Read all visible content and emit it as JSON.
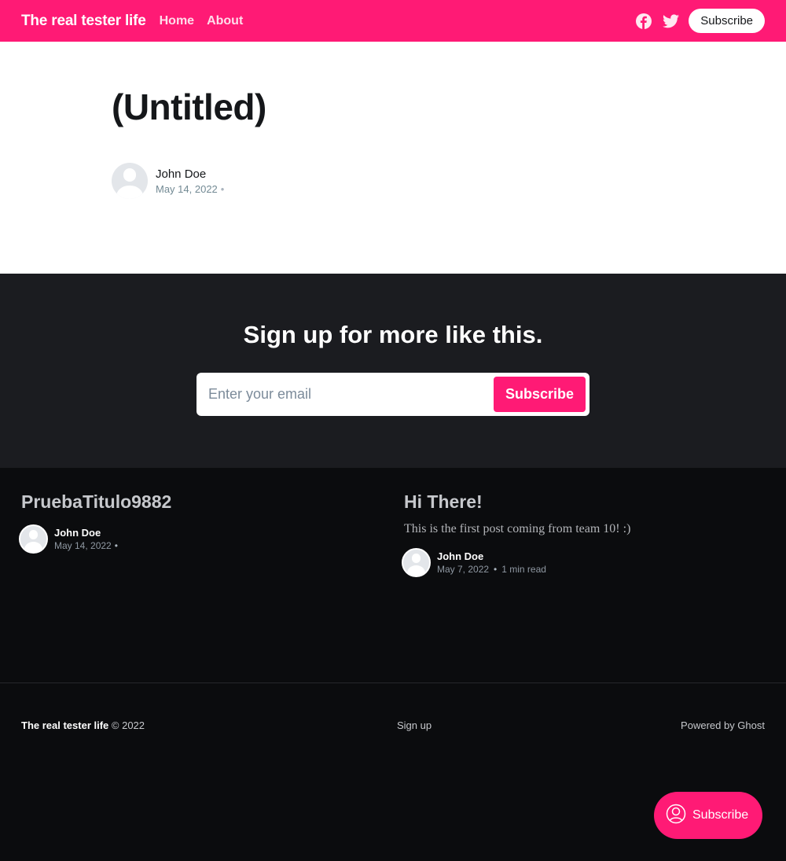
{
  "header": {
    "brand": "The real tester life",
    "nav": [
      {
        "label": "Home"
      },
      {
        "label": "About"
      }
    ],
    "subscribe_label": "Subscribe",
    "accent_color": "#ff1a75",
    "icons": [
      "facebook-icon",
      "twitter-icon"
    ]
  },
  "article": {
    "title": "(Untitled)",
    "author": "John Doe",
    "date": "May 14, 2022",
    "separator": "•"
  },
  "signup": {
    "heading": "Sign up for more like this.",
    "email_placeholder": "Enter your email",
    "button_label": "Subscribe"
  },
  "posts": [
    {
      "title": "PruebaTitulo9882",
      "excerpt": "",
      "author": "John Doe",
      "date": "May 14, 2022",
      "separator": "•",
      "reading_time": ""
    },
    {
      "title": "Hi There!",
      "excerpt": "This is the first post coming from team 10! :)",
      "author": "John Doe",
      "date": "May 7, 2022",
      "separator": "•",
      "reading_time": "1 min read"
    }
  ],
  "footer": {
    "brand": "The real tester life",
    "copyright": "© 2022",
    "signup_link": "Sign up",
    "powered_by": "Powered by Ghost"
  },
  "portal": {
    "label": "Subscribe"
  }
}
